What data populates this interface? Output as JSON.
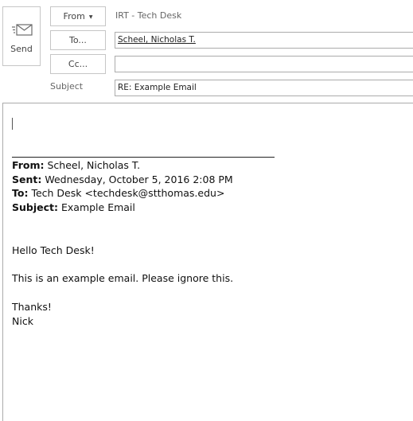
{
  "send_button": {
    "label": "Send",
    "icon": "send-envelope-icon"
  },
  "header": {
    "from_button": "From",
    "from_value": "IRT - Tech Desk",
    "to_button": "To...",
    "cc_button": "Cc...",
    "subject_label": "Subject"
  },
  "fields": {
    "to_value": "Scheel, Nicholas T.",
    "cc_value": "",
    "subject_value": "RE: Example Email"
  },
  "quoted": {
    "from_label": "From:",
    "from_value": "Scheel, Nicholas T.",
    "sent_label": "Sent:",
    "sent_value": "Wednesday, October 5, 2016 2:08 PM",
    "to_label": "To:",
    "to_value": "Tech Desk <techdesk@stthomas.edu>",
    "subject_label": "Subject:",
    "subject_value": "Example Email"
  },
  "body": {
    "greeting": "Hello Tech Desk!",
    "line1": "This is an example email. Please ignore this.",
    "closing": "Thanks!",
    "signature": "Nick"
  }
}
